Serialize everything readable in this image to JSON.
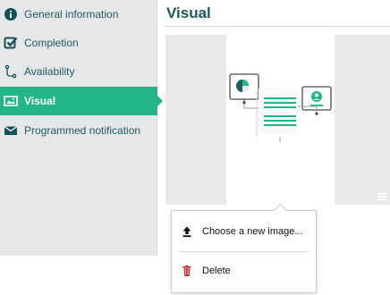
{
  "sidebar": {
    "items": [
      {
        "label": "General information",
        "icon": "info-circle-icon",
        "active": false
      },
      {
        "label": "Completion",
        "icon": "check-square-icon",
        "active": false
      },
      {
        "label": "Availability",
        "icon": "branch-icon",
        "active": false
      },
      {
        "label": "Visual",
        "icon": "image-icon",
        "active": true
      },
      {
        "label": "Programmed notification",
        "icon": "envelope-icon",
        "active": false
      }
    ]
  },
  "main": {
    "title": "Visual"
  },
  "popup_menu": {
    "items": [
      {
        "label": "Choose a new image...",
        "icon": "upload-icon"
      },
      {
        "label": "Delete",
        "icon": "trash-icon"
      }
    ]
  },
  "colors": {
    "accent": "#22b58a",
    "title": "#1e5a60",
    "sidebar_bg": "#e6e7e9",
    "delete_red": "#c0292b"
  }
}
